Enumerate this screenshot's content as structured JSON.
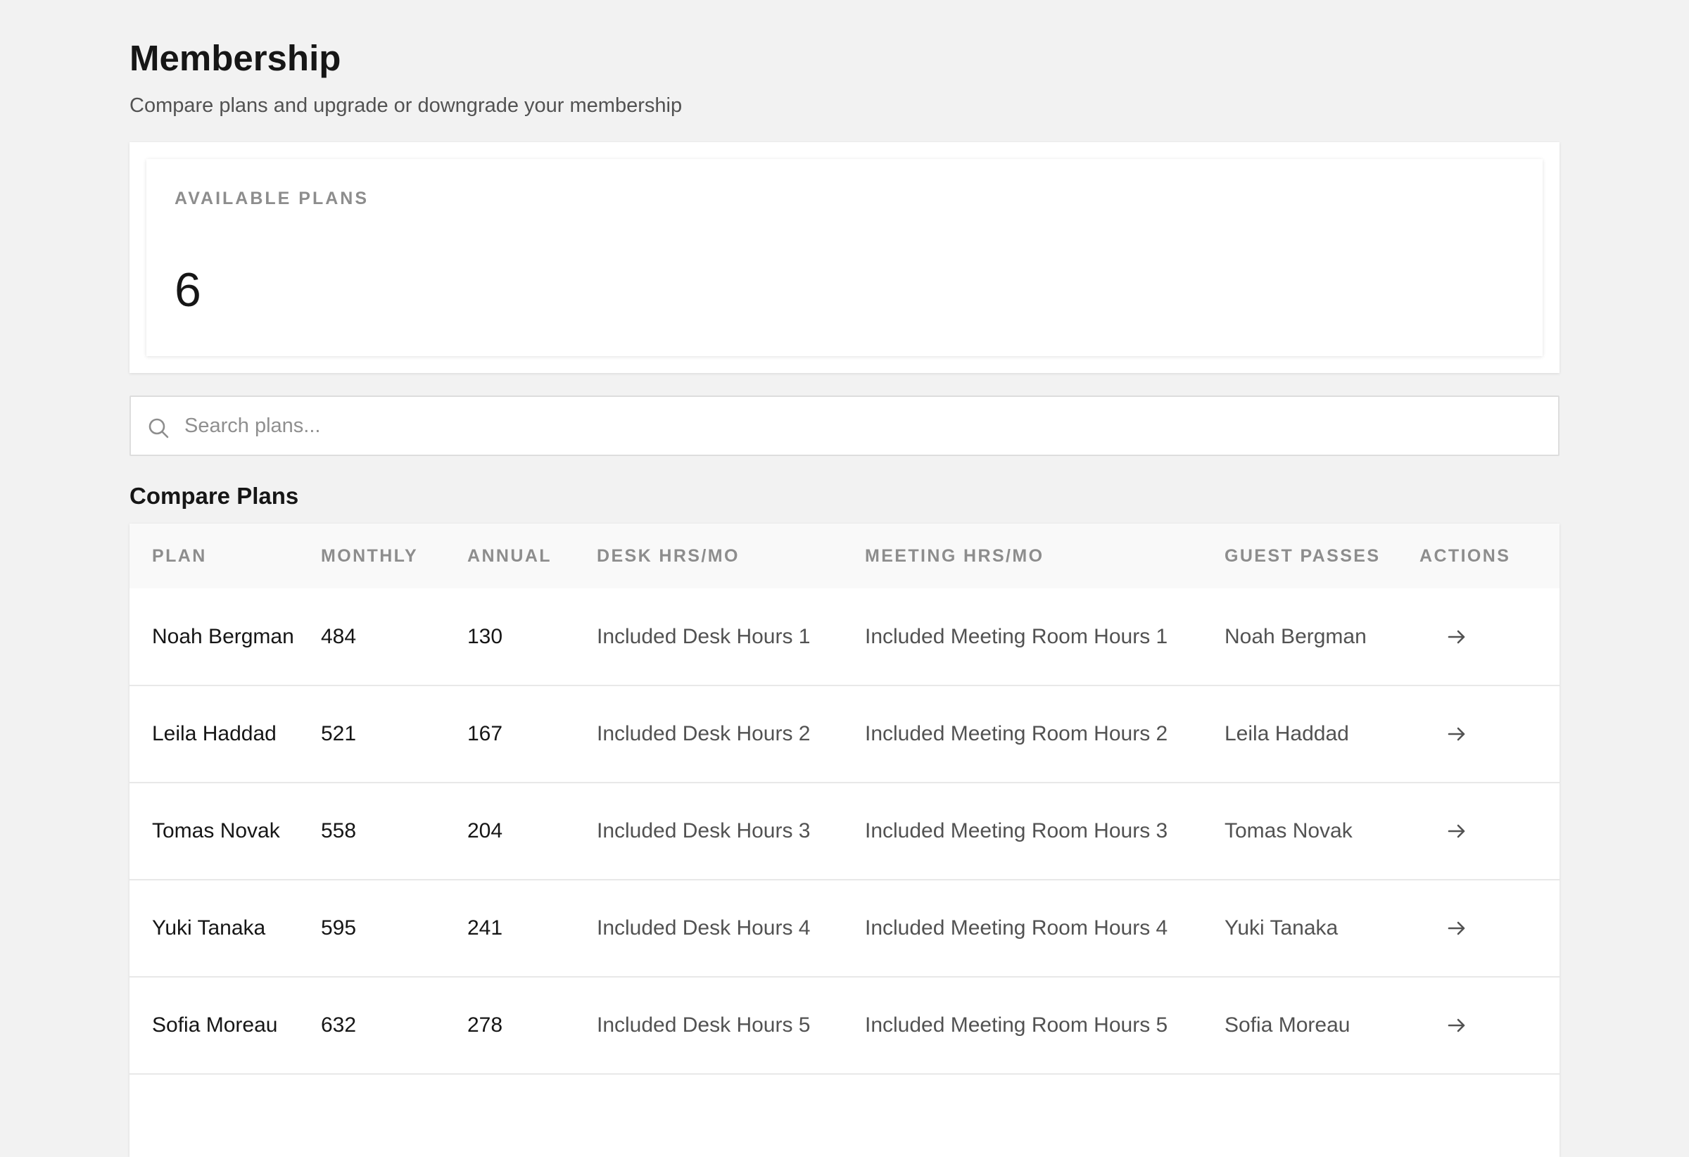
{
  "header": {
    "title": "Membership",
    "subtitle": "Compare plans and upgrade or downgrade your membership"
  },
  "stats": {
    "label": "AVAILABLE PLANS",
    "value": "6"
  },
  "search": {
    "placeholder": "Search plans...",
    "value": "",
    "icon": "search-icon"
  },
  "section": {
    "title": "Compare Plans"
  },
  "table": {
    "columns": [
      "PLAN",
      "MONTHLY",
      "ANNUAL",
      "DESK HRS/MO",
      "MEETING HRS/MO",
      "GUEST PASSES",
      "ACTIONS"
    ],
    "rows": [
      {
        "plan": "Noah Bergman",
        "monthly": "484",
        "annual": "130",
        "desk": "Included Desk Hours 1",
        "meeting": "Included Meeting Room Hours 1",
        "guest": "Noah Bergman",
        "action_icon": "arrow-right-icon"
      },
      {
        "plan": "Leila Haddad",
        "monthly": "521",
        "annual": "167",
        "desk": "Included Desk Hours 2",
        "meeting": "Included Meeting Room Hours 2",
        "guest": "Leila Haddad",
        "action_icon": "arrow-right-icon"
      },
      {
        "plan": "Tomas Novak",
        "monthly": "558",
        "annual": "204",
        "desk": "Included Desk Hours 3",
        "meeting": "Included Meeting Room Hours 3",
        "guest": "Tomas Novak",
        "action_icon": "arrow-right-icon"
      },
      {
        "plan": "Yuki Tanaka",
        "monthly": "595",
        "annual": "241",
        "desk": "Included Desk Hours 4",
        "meeting": "Included Meeting Room Hours 4",
        "guest": "Yuki Tanaka",
        "action_icon": "arrow-right-icon"
      },
      {
        "plan": "Sofia Moreau",
        "monthly": "632",
        "annual": "278",
        "desk": "Included Desk Hours 5",
        "meeting": "Included Meeting Room Hours 5",
        "guest": "Sofia Moreau",
        "action_icon": "arrow-right-icon"
      }
    ]
  },
  "colors": {
    "background": "#f2f2f2",
    "card": "#ffffff",
    "text_primary": "#161616",
    "text_secondary": "#525252",
    "text_muted": "#8d8d8d",
    "border": "#e8e8e8"
  }
}
